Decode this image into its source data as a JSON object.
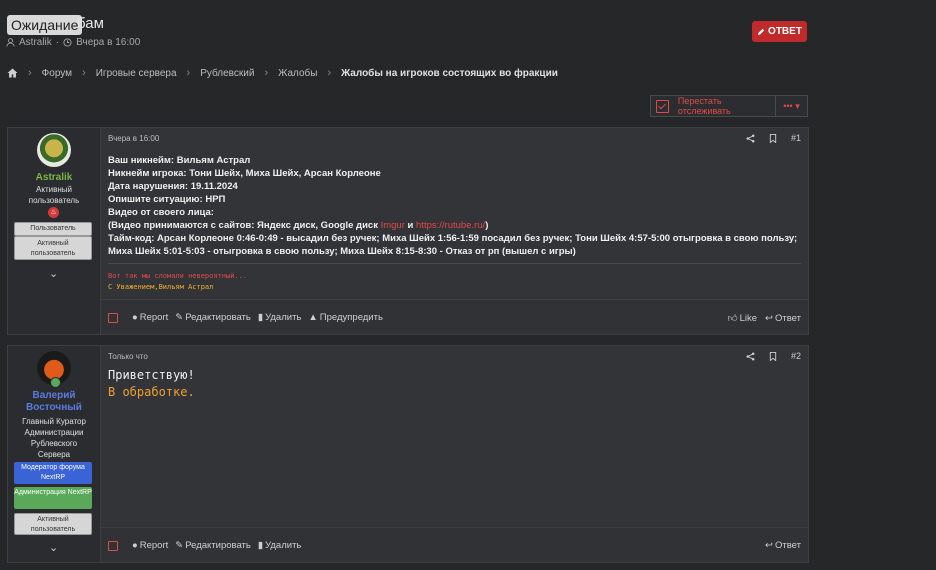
{
  "thread": {
    "prefix": "Ожидание",
    "title": "бам",
    "author": "Astralik",
    "time": "Вчера в 16:00",
    "reply_label": "ОТВЕТ"
  },
  "breadcrumb": [
    "Форум",
    "Игровые сервера",
    "Рублевский",
    "Жалобы",
    "Жалобы на игроков состоящих во фракции"
  ],
  "watch_label": "Перестать отслеживать",
  "more_label": "•••",
  "posts": [
    {
      "time": "Вчера в 16:00",
      "number": "#1",
      "user": {
        "name": "Astralik",
        "title": "Активный пользователь",
        "banners": [
          "Пользователь",
          "Активный пользователь"
        ]
      },
      "lines": [
        "Ваш никнейм: Вильям Астрал",
        "Никнейм игрока: Тони Шейх, Миха Шейх, Арсан Корлеоне",
        "Дата нарушения: 19.11.2024",
        "Опишите ситуацию: НРП",
        "Видео от своего лица:",
        "(Видео принимаются с сайтов: Яндекс диск, Google диск",
        "Imgur",
        "и",
        "https://rutube.ru/",
        ")",
        "Тайм-код: Арсан Корлеоне 0:46-0:49 - высадил без ручек; Миха Шейх 1:56-1:59 посадил без ручек; Тони Шейх 4:57-5:00 отыгровка в свою пользу; Миха Шейх 5:01-5:03 - отыгровка в свою пользу; Миха Шейх 8:15-8:30 - Отказ от рп (вышел с игры)"
      ],
      "signature": [
        "Вот так мы сломали невероятный...",
        "С Уважением,Вильям Астрал"
      ],
      "actions": [
        "Report",
        "Редактировать",
        "Удалить",
        "Предупредить"
      ],
      "right_actions": [
        "Like",
        "Ответ"
      ]
    },
    {
      "time": "Только что",
      "number": "#2",
      "user": {
        "name": "Валерий Восточный",
        "title": "Главный Куратор Администрации Рублевского Сервера",
        "banners": [
          "Модератор форума NextRP",
          "Администрация NextRP",
          "Активный пользователь"
        ]
      },
      "lines": [
        "Приветствую!",
        "В обработке."
      ],
      "actions": [
        "Report",
        "Редактировать",
        "Удалить"
      ],
      "right_actions": [
        "Ответ"
      ]
    }
  ],
  "colors": {
    "accent_red": "#c02a2a",
    "link_red": "#e04a4a",
    "processing_orange": "#f0a030",
    "moderator_blue": "#3a63d6",
    "admin_green": "#5aa95a",
    "username_blue": "#5b7be0",
    "username_green": "#7ab648"
  }
}
